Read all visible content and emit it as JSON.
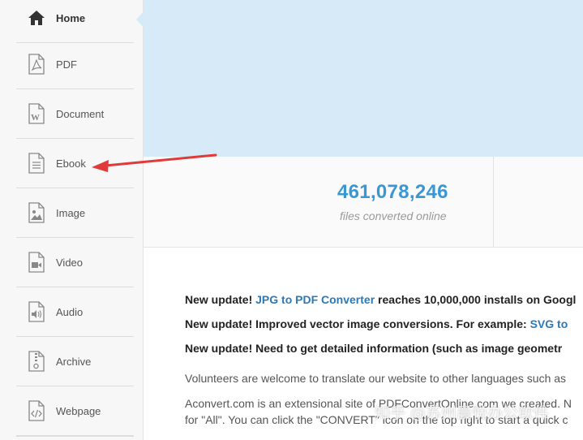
{
  "sidebar": {
    "items": [
      {
        "label": "Home",
        "icon": "home-icon"
      },
      {
        "label": "PDF",
        "icon": "pdf-file-icon"
      },
      {
        "label": "Document",
        "icon": "word-document-icon"
      },
      {
        "label": "Ebook",
        "icon": "ebook-file-icon"
      },
      {
        "label": "Image",
        "icon": "image-file-icon"
      },
      {
        "label": "Video",
        "icon": "video-file-icon"
      },
      {
        "label": "Audio",
        "icon": "audio-file-icon"
      },
      {
        "label": "Archive",
        "icon": "archive-file-icon"
      },
      {
        "label": "Webpage",
        "icon": "webpage-file-icon"
      }
    ]
  },
  "stats": {
    "count": "461,078,246",
    "caption": "files converted online"
  },
  "updates": {
    "line1_prefix": "New update! ",
    "line1_link": "JPG to PDF Converter",
    "line1_suffix": " reaches 10,000,000 installs on Googl",
    "line2_prefix": "New update! Improved vector image conversions. For example: ",
    "line2_link": "SVG to",
    "line3": "New update! Need to get detailed information (such as image geometr"
  },
  "paragraphs": {
    "volunteers": "Volunteers are welcome to translate our website to other languages such as",
    "about_line1": "Aconvert.com is an extensional site of PDFConvertOnline.com we created. N",
    "about_line2": "for \"All\". You can click the \"CONVERT\" icon on the top right to start a quick c"
  },
  "watermark": "知乎 @苏州晨悦办公软件",
  "colors": {
    "sidebar_bg": "#f7f7f7",
    "banner_bg": "#d6ebf7",
    "stat_number": "#3a97d4",
    "link": "#2a7ab8",
    "arrow": "#e03a3a"
  }
}
